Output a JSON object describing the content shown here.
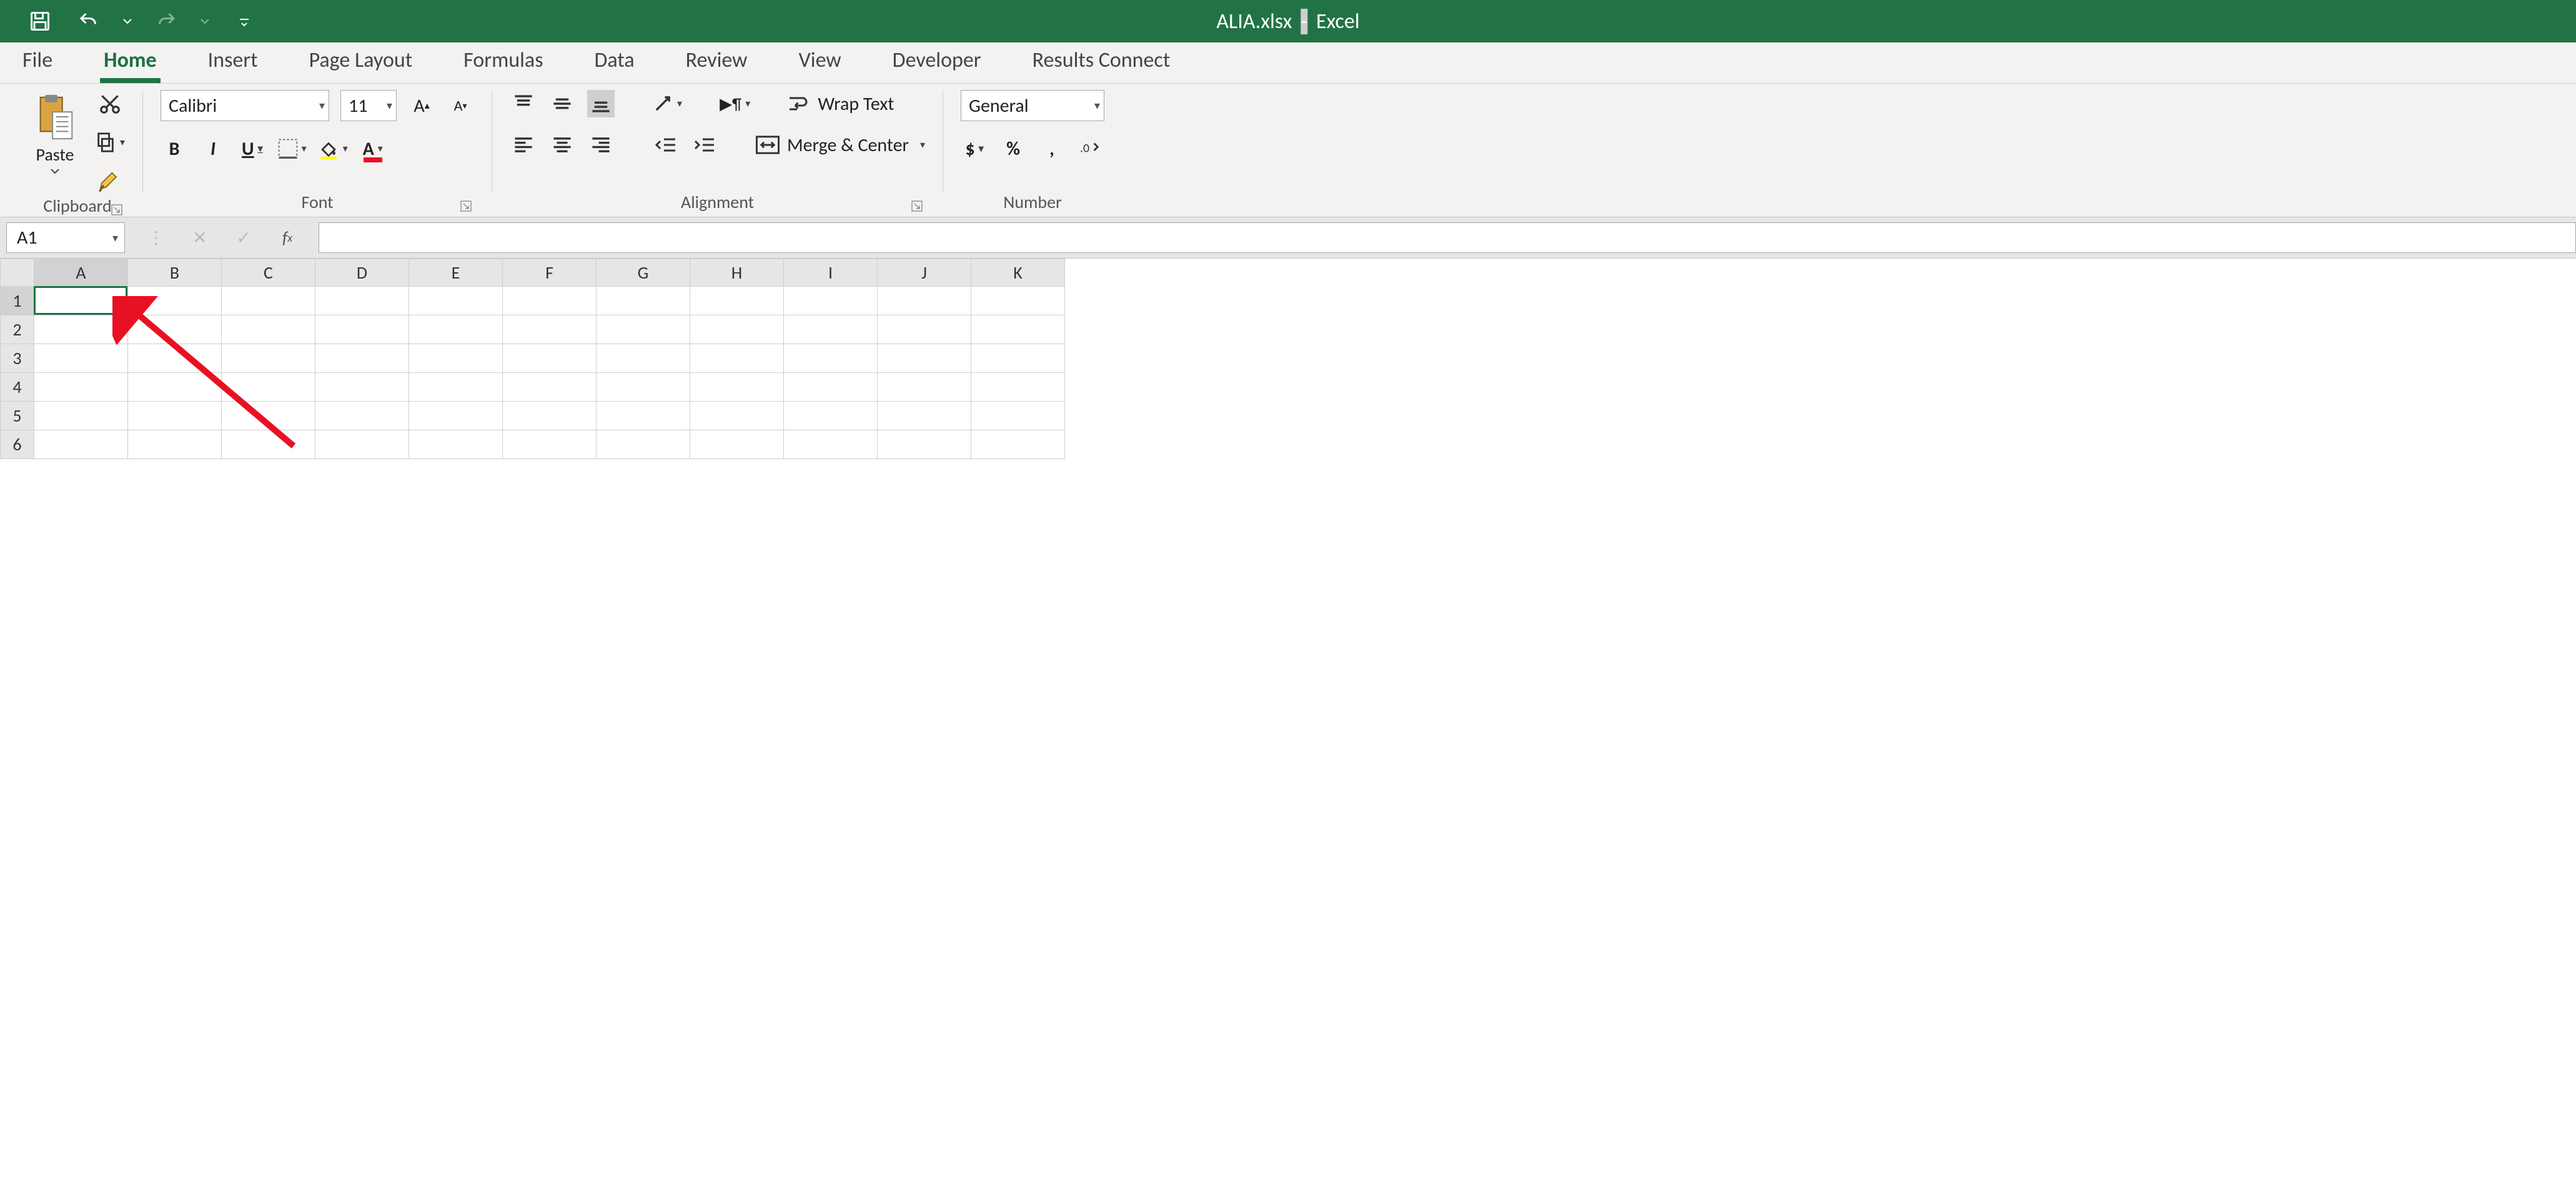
{
  "title": {
    "filename": "ALIA.xlsx",
    "app": "Excel"
  },
  "qat": {
    "save": "Save",
    "undo": "Undo",
    "redo": "Redo",
    "customize": "Customize Quick Access Toolbar"
  },
  "tabs": [
    "File",
    "Home",
    "Insert",
    "Page Layout",
    "Formulas",
    "Data",
    "Review",
    "View",
    "Developer",
    "Results Connect"
  ],
  "active_tab": "Home",
  "ribbon": {
    "clipboard": {
      "label": "Clipboard",
      "paste": "Paste"
    },
    "font": {
      "label": "Font",
      "name": "Calibri",
      "size": "11",
      "bold": "B",
      "italic": "I",
      "underline": "U"
    },
    "alignment": {
      "label": "Alignment",
      "wrap": "Wrap Text",
      "merge": "Merge & Center"
    },
    "number": {
      "label": "Number",
      "format": "General",
      "currency": "$",
      "percent": "%",
      "comma": ","
    }
  },
  "formula_bar": {
    "namebox": "A1",
    "value": ""
  },
  "grid": {
    "columns": [
      "A",
      "B",
      "C",
      "D",
      "E",
      "F",
      "G",
      "H",
      "I",
      "J",
      "K"
    ],
    "rows": [
      "1",
      "2",
      "3",
      "4",
      "5",
      "6"
    ],
    "selected_cell": "A1"
  },
  "icons": {
    "launcher": "↘"
  }
}
